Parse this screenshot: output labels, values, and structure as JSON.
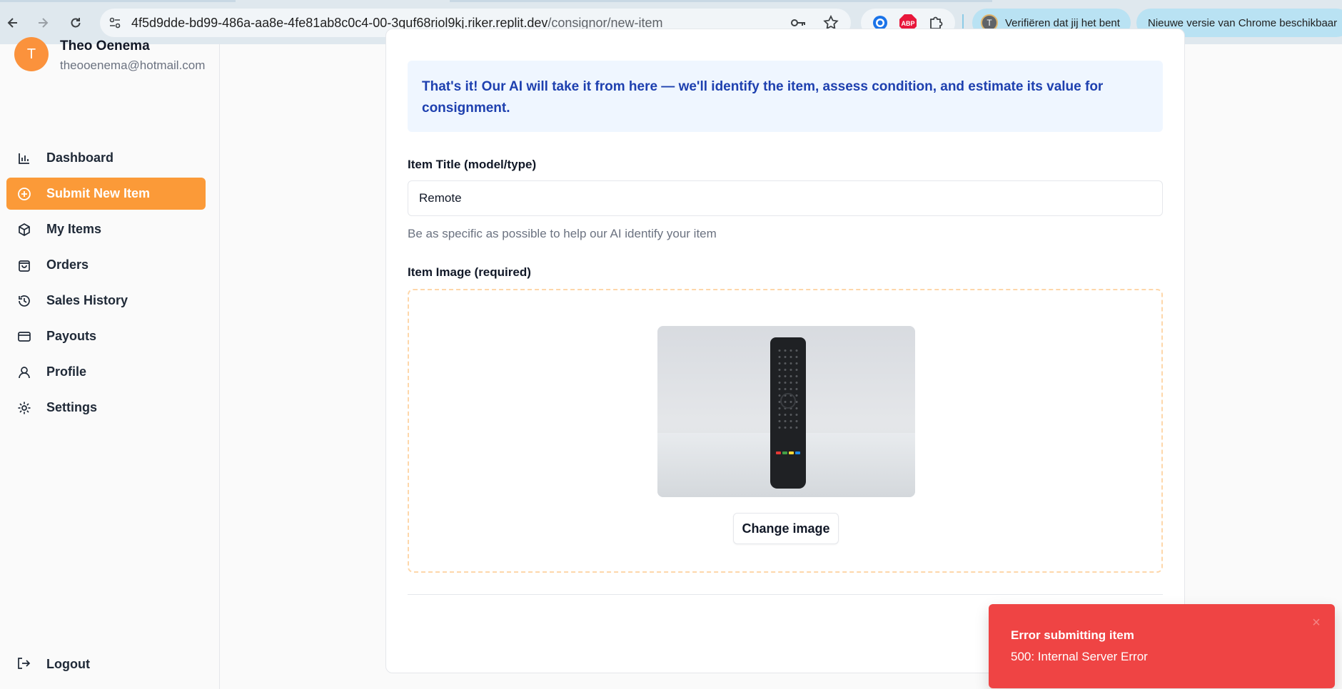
{
  "browser": {
    "url_host": "4f5d9dde-bd99-486a-aa8e-4fe81ab8c0c4-00-3quf68riol9kj.riker.replit.dev",
    "url_path": "/consignor/new-item",
    "verify_chip": "Verifiëren dat jij het bent",
    "verify_avatar": "T",
    "update_chip": "Nieuwe versie van Chrome beschikbaar",
    "abp_label": "ABP"
  },
  "sidebar": {
    "avatar_letter": "T",
    "user_name": "Theo Oenema",
    "user_email": "theooenema@hotmail.com",
    "items": [
      {
        "label": "Dashboard",
        "icon": "bar-chart-icon"
      },
      {
        "label": "Submit New Item",
        "icon": "plus-circle-icon",
        "active": true
      },
      {
        "label": "My Items",
        "icon": "package-icon"
      },
      {
        "label": "Orders",
        "icon": "shopping-bag-icon"
      },
      {
        "label": "Sales History",
        "icon": "history-icon"
      },
      {
        "label": "Payouts",
        "icon": "credit-card-icon"
      },
      {
        "label": "Profile",
        "icon": "user-icon"
      },
      {
        "label": "Settings",
        "icon": "gear-icon"
      }
    ],
    "logout_label": "Logout"
  },
  "form": {
    "info_text": "That's it! Our AI will take it from here — we'll identify the item, assess condition, and estimate its value for consignment.",
    "title_label": "Item Title (model/type)",
    "title_value": "Remote",
    "title_hint": "Be as specific as possible to help our AI identify your item",
    "image_label": "Item Image (required)",
    "change_image_label": "Change image"
  },
  "toast": {
    "title": "Error submitting item",
    "description": "500: Internal Server Error",
    "accent": "#ef4444"
  },
  "colors": {
    "accent": "#fb9a38",
    "info_bg": "#eff6ff",
    "info_text": "#1e40af"
  }
}
